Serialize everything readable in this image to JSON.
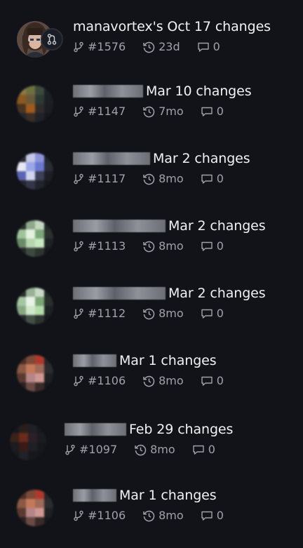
{
  "items": [
    {
      "title": "manavortex's Oct 17 changes",
      "pr": "#1576",
      "age": "23d",
      "comments": "0",
      "avatar_colors": [
        "#3b2a24",
        "#6b5040",
        "#2b2a30",
        "#1d1c22",
        "#8c6e58",
        "#c6a08a",
        "#3a3f4e",
        "#2a2d36",
        "#4a3a30",
        "#7a6a62",
        "#51545e",
        "#222429",
        "#2a2d33",
        "#5a5c66",
        "#3d404a",
        "#1b1d22"
      ]
    },
    {
      "title": "Mar 10 changes",
      "pr": "#1147",
      "age": "7mo",
      "comments": "0",
      "avatar_colors": [
        "#8a7a4a",
        "#6d7040",
        "#3c4a3c",
        "#1e2226",
        "#8a5a20",
        "#6a5a3a",
        "#2c3a34",
        "#1c2026",
        "#4a3420",
        "#a05a1c",
        "#2e2c2a",
        "#1a1d22",
        "#25282c",
        "#3a2e26",
        "#202328",
        "#16181c"
      ]
    },
    {
      "title": "Mar 2 changes",
      "pr": "#1117",
      "age": "8mo",
      "comments": "0",
      "avatar_colors": [
        "#2a2c36",
        "#c4c8e6",
        "#8c94d8",
        "#22252c",
        "#e6e8f4",
        "#9aa6e8",
        "#6a78d0",
        "#2a2c34",
        "#5a64b0",
        "#d0d4ee",
        "#3c3f58",
        "#1c1f24",
        "#24262e",
        "#34364a",
        "#22242c",
        "#16181c"
      ]
    },
    {
      "title": "Mar 2 changes",
      "pr": "#1113",
      "age": "8mo",
      "comments": "0",
      "avatar_colors": [
        "#2a2e2c",
        "#8ea88c",
        "#c4d8c0",
        "#22262a",
        "#9ec49a",
        "#e4f0e0",
        "#7aa878",
        "#2c302e",
        "#6a8a68",
        "#b8d4b0",
        "#c8e8c2",
        "#1e2224",
        "#24282a",
        "#3e4a40",
        "#2e3430",
        "#16181c"
      ]
    },
    {
      "title": "Mar 2 changes",
      "pr": "#1112",
      "age": "8mo",
      "comments": "0",
      "avatar_colors": [
        "#2a2e2c",
        "#9ab096",
        "#c8dac4",
        "#22262a",
        "#a4c6a0",
        "#e8f2e6",
        "#7aa676",
        "#2a2e2c",
        "#88a884",
        "#d0e8ca",
        "#b4dca8",
        "#1e2224",
        "#24282a",
        "#445046",
        "#2e3430",
        "#16181c"
      ]
    },
    {
      "title": "Mar 1 changes",
      "pr": "#1106",
      "age": "8mo",
      "comments": "0",
      "avatar_colors": [
        "#4a3026",
        "#7a4a36",
        "#b03a2a",
        "#22252a",
        "#8a5a44",
        "#c47a5a",
        "#a06a58",
        "#2a2c30",
        "#5a3a30",
        "#b4868a",
        "#d09890",
        "#1e2024",
        "#2a2224",
        "#6a4a44",
        "#3a2a2a",
        "#16181c"
      ]
    },
    {
      "title": "Feb 29 changes",
      "pr": "#1097",
      "age": "8mo",
      "comments": "0",
      "avatar_colors": [
        "#16181c",
        "#2a1e1c",
        "#1e2026",
        "#16181c",
        "#3a2218",
        "#6a2a1c",
        "#2a2026",
        "#1a1c20",
        "#1a1c20",
        "#3a1a14",
        "#1e2026",
        "#16181c",
        "#16181c",
        "#202228",
        "#16181c",
        "#14161a"
      ]
    },
    {
      "title": "Mar 1 changes",
      "pr": "#1106",
      "age": "8mo",
      "comments": "0",
      "avatar_colors": [
        "#4a3026",
        "#7a4a36",
        "#b03a2a",
        "#22252a",
        "#8a5a44",
        "#c47a5a",
        "#a06a58",
        "#2a2c30",
        "#5a3a30",
        "#b4868a",
        "#d09890",
        "#1e2024",
        "#2a2224",
        "#6a4a44",
        "#3a2a2a",
        "#16181c"
      ]
    }
  ]
}
